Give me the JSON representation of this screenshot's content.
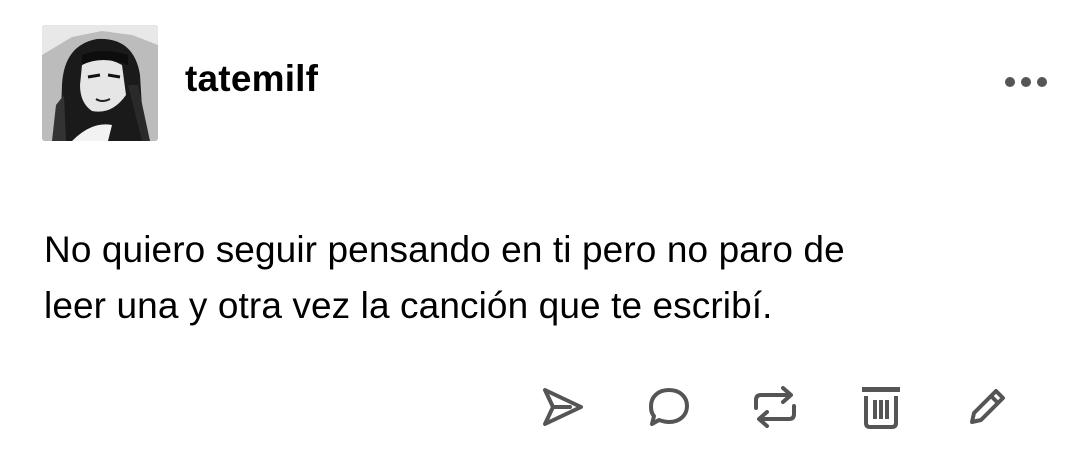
{
  "post": {
    "username": "tatemilf",
    "text_line_1": "No quiero seguir pensando en ti pero no paro de",
    "text_line_2": "leer una y otra vez la canción que te escribí."
  },
  "header": {
    "avatar_icon": "avatar-image",
    "more_icon": "ellipsis-icon"
  },
  "actions": [
    {
      "icon": "send-icon"
    },
    {
      "icon": "reply-icon"
    },
    {
      "icon": "reblog-icon"
    },
    {
      "icon": "trash-icon"
    },
    {
      "icon": "edit-icon"
    }
  ],
  "colors": {
    "background": "#ffffff",
    "text": "#000000",
    "icon": "#555555"
  }
}
